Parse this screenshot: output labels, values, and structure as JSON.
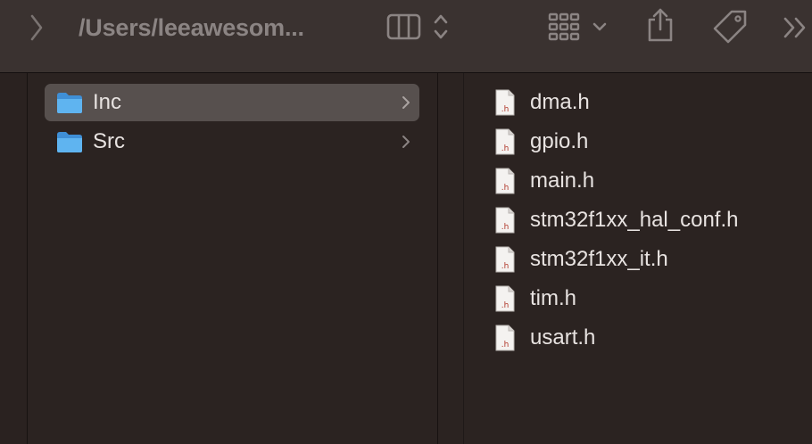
{
  "toolbar": {
    "path_title": "/Users/leeawesom...",
    "icons": [
      "back-chevron-icon",
      "column-view-icon",
      "up-down-chevron-icon",
      "grid-view-icon",
      "chevron-down-icon",
      "share-icon",
      "tag-icon",
      "more-chevrons-icon"
    ]
  },
  "folders": [
    {
      "name": "Inc",
      "selected": true
    },
    {
      "name": "Src",
      "selected": false
    }
  ],
  "files": [
    {
      "name": "dma.h",
      "badge": ".h"
    },
    {
      "name": "gpio.h",
      "badge": ".h"
    },
    {
      "name": "main.h",
      "badge": ".h"
    },
    {
      "name": "stm32f1xx_hal_conf.h",
      "badge": ".h"
    },
    {
      "name": "stm32f1xx_it.h",
      "badge": ".h"
    },
    {
      "name": "tim.h",
      "badge": ".h"
    },
    {
      "name": "usart.h",
      "badge": ".h"
    }
  ],
  "colors": {
    "background": "#2b2321",
    "toolbar": "#3a3230",
    "selection": "#57504e",
    "folder_blue": "#5fb4f0",
    "icon_gray": "#8b8483"
  }
}
